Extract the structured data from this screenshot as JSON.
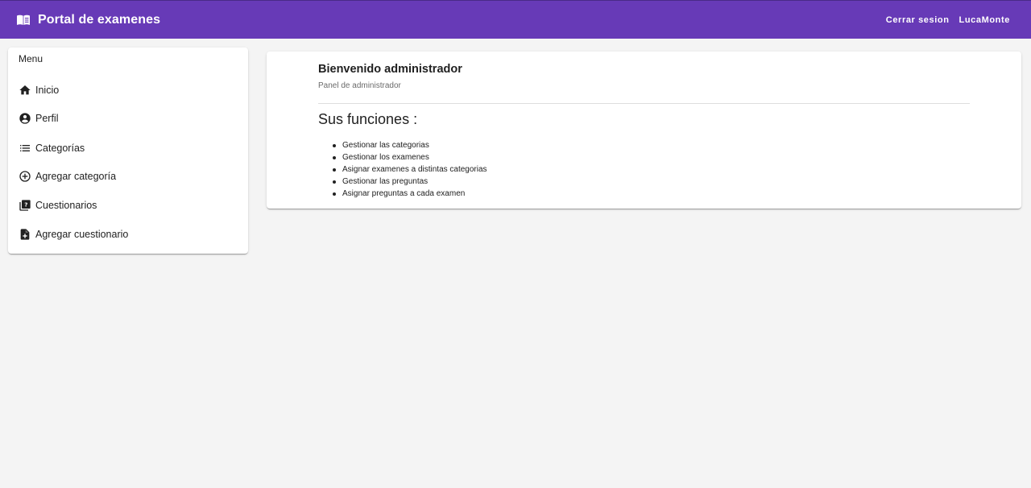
{
  "header": {
    "title": "Portal de examenes",
    "icon": "menu-book-icon",
    "actions": [
      "Cerrar sesion",
      "LucaMonte"
    ],
    "background_color": "#673ab7"
  },
  "sidebar": {
    "header": "Menu",
    "items": [
      {
        "label": "Inicio",
        "icon": "home-icon"
      },
      {
        "label": "Perfil",
        "icon": "account-circle-icon"
      },
      {
        "label": "Categorías",
        "icon": "list-icon"
      },
      {
        "label": "Agregar categoría",
        "icon": "add-circle-outline-icon"
      },
      {
        "label": "Cuestionarios",
        "icon": "quiz-icon"
      },
      {
        "label": "Agregar cuestionario",
        "icon": "note-add-icon"
      }
    ]
  },
  "main": {
    "title": "Bienvenido administrador",
    "subtitle": "Panel de administrador",
    "section_title": "Sus funciones :",
    "functions": [
      "Gestionar las categorias",
      "Gestionar los examenes",
      "Asignar examenes a distintas categorias",
      "Gestionar las preguntas",
      "Asignar preguntas a cada examen"
    ]
  }
}
